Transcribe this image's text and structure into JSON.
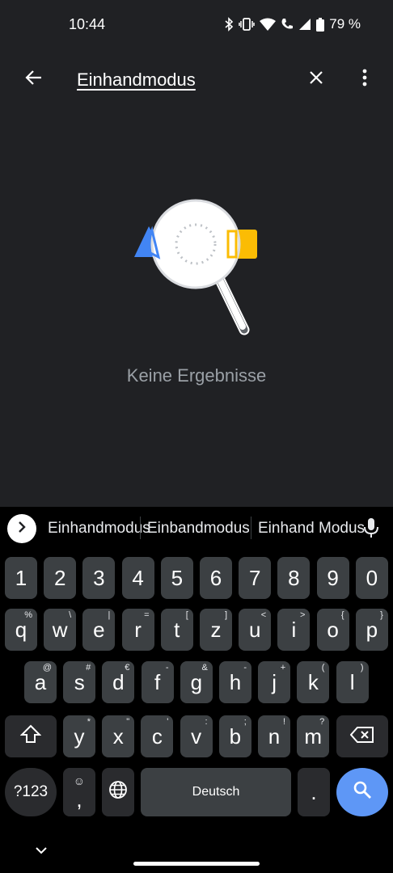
{
  "status_bar": {
    "time": "10:44",
    "battery": "79 %"
  },
  "search": {
    "query": "Einhandmodus"
  },
  "empty_state": {
    "message": "Keine Ergebnisse"
  },
  "suggestions": [
    "Einhandmodus",
    "Einbandmodus",
    "Einhand Modus"
  ],
  "keyboard": {
    "numbers": [
      "1",
      "2",
      "3",
      "4",
      "5",
      "6",
      "7",
      "8",
      "9",
      "0"
    ],
    "row1": [
      {
        "k": "q",
        "h": "%"
      },
      {
        "k": "w",
        "h": "\\"
      },
      {
        "k": "e",
        "h": "|"
      },
      {
        "k": "r",
        "h": "="
      },
      {
        "k": "t",
        "h": "["
      },
      {
        "k": "z",
        "h": "]"
      },
      {
        "k": "u",
        "h": "<"
      },
      {
        "k": "i",
        "h": ">"
      },
      {
        "k": "o",
        "h": "{"
      },
      {
        "k": "p",
        "h": "}"
      }
    ],
    "row2": [
      {
        "k": "a",
        "h": "@"
      },
      {
        "k": "s",
        "h": "#"
      },
      {
        "k": "d",
        "h": "€"
      },
      {
        "k": "f",
        "h": "-"
      },
      {
        "k": "g",
        "h": "&"
      },
      {
        "k": "h",
        "h": "-"
      },
      {
        "k": "j",
        "h": "+"
      },
      {
        "k": "k",
        "h": "("
      },
      {
        "k": "l",
        "h": ")"
      }
    ],
    "row3": [
      {
        "k": "y",
        "h": "*"
      },
      {
        "k": "x",
        "h": "\""
      },
      {
        "k": "c",
        "h": "'"
      },
      {
        "k": "v",
        "h": ":"
      },
      {
        "k": "b",
        "h": ";"
      },
      {
        "k": "n",
        "h": "!"
      },
      {
        "k": "m",
        "h": "?"
      }
    ],
    "symbols_label": "?123",
    "comma_label": ",",
    "space_label": "Deutsch",
    "period_label": "."
  },
  "colors": {
    "background": "#202124",
    "accent": "#5e97f6",
    "key": "#3c4043"
  }
}
